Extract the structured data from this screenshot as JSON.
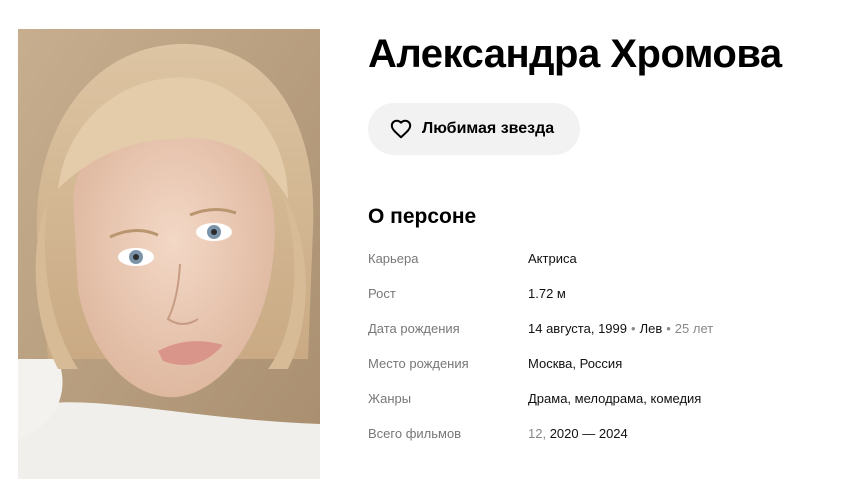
{
  "person": {
    "name": "Александра Хромова",
    "favorite_label": "Любимая звезда",
    "heart_icon": "heart-icon"
  },
  "about": {
    "title": "О персоне",
    "career": {
      "label": "Карьера",
      "value": "Актриса"
    },
    "height": {
      "label": "Рост",
      "value": "1.72 м"
    },
    "birth": {
      "label": "Дата рождения",
      "date": "14 августа, 1999",
      "sep1": "•",
      "zodiac": "Лев",
      "sep2": "•",
      "age": "25 лет"
    },
    "birthplace": {
      "label": "Место рождения",
      "value": "Москва, Россия"
    },
    "genres": {
      "label": "Жанры",
      "value": "Драма, мелодрама, комедия"
    },
    "films": {
      "label": "Всего фильмов",
      "count": "12,",
      "years": "2020 — 2024"
    }
  }
}
